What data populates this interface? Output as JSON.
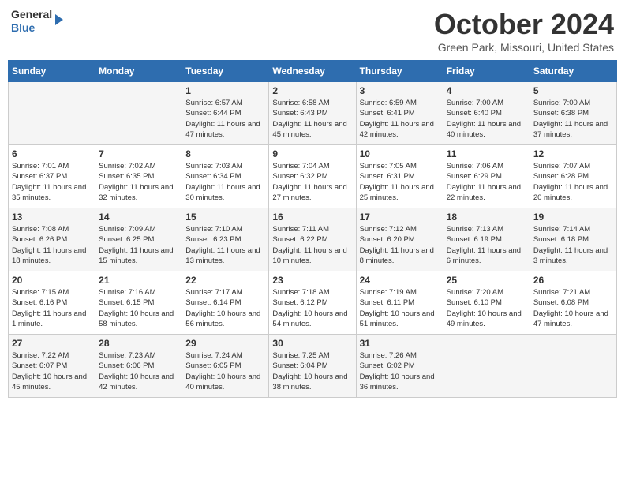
{
  "header": {
    "logo_line1": "General",
    "logo_line2": "Blue",
    "month_title": "October 2024",
    "location": "Green Park, Missouri, United States"
  },
  "weekdays": [
    "Sunday",
    "Monday",
    "Tuesday",
    "Wednesday",
    "Thursday",
    "Friday",
    "Saturday"
  ],
  "weeks": [
    [
      {
        "day": "",
        "sunrise": "",
        "sunset": "",
        "daylight": ""
      },
      {
        "day": "",
        "sunrise": "",
        "sunset": "",
        "daylight": ""
      },
      {
        "day": "1",
        "sunrise": "Sunrise: 6:57 AM",
        "sunset": "Sunset: 6:44 PM",
        "daylight": "Daylight: 11 hours and 47 minutes."
      },
      {
        "day": "2",
        "sunrise": "Sunrise: 6:58 AM",
        "sunset": "Sunset: 6:43 PM",
        "daylight": "Daylight: 11 hours and 45 minutes."
      },
      {
        "day": "3",
        "sunrise": "Sunrise: 6:59 AM",
        "sunset": "Sunset: 6:41 PM",
        "daylight": "Daylight: 11 hours and 42 minutes."
      },
      {
        "day": "4",
        "sunrise": "Sunrise: 7:00 AM",
        "sunset": "Sunset: 6:40 PM",
        "daylight": "Daylight: 11 hours and 40 minutes."
      },
      {
        "day": "5",
        "sunrise": "Sunrise: 7:00 AM",
        "sunset": "Sunset: 6:38 PM",
        "daylight": "Daylight: 11 hours and 37 minutes."
      }
    ],
    [
      {
        "day": "6",
        "sunrise": "Sunrise: 7:01 AM",
        "sunset": "Sunset: 6:37 PM",
        "daylight": "Daylight: 11 hours and 35 minutes."
      },
      {
        "day": "7",
        "sunrise": "Sunrise: 7:02 AM",
        "sunset": "Sunset: 6:35 PM",
        "daylight": "Daylight: 11 hours and 32 minutes."
      },
      {
        "day": "8",
        "sunrise": "Sunrise: 7:03 AM",
        "sunset": "Sunset: 6:34 PM",
        "daylight": "Daylight: 11 hours and 30 minutes."
      },
      {
        "day": "9",
        "sunrise": "Sunrise: 7:04 AM",
        "sunset": "Sunset: 6:32 PM",
        "daylight": "Daylight: 11 hours and 27 minutes."
      },
      {
        "day": "10",
        "sunrise": "Sunrise: 7:05 AM",
        "sunset": "Sunset: 6:31 PM",
        "daylight": "Daylight: 11 hours and 25 minutes."
      },
      {
        "day": "11",
        "sunrise": "Sunrise: 7:06 AM",
        "sunset": "Sunset: 6:29 PM",
        "daylight": "Daylight: 11 hours and 22 minutes."
      },
      {
        "day": "12",
        "sunrise": "Sunrise: 7:07 AM",
        "sunset": "Sunset: 6:28 PM",
        "daylight": "Daylight: 11 hours and 20 minutes."
      }
    ],
    [
      {
        "day": "13",
        "sunrise": "Sunrise: 7:08 AM",
        "sunset": "Sunset: 6:26 PM",
        "daylight": "Daylight: 11 hours and 18 minutes."
      },
      {
        "day": "14",
        "sunrise": "Sunrise: 7:09 AM",
        "sunset": "Sunset: 6:25 PM",
        "daylight": "Daylight: 11 hours and 15 minutes."
      },
      {
        "day": "15",
        "sunrise": "Sunrise: 7:10 AM",
        "sunset": "Sunset: 6:23 PM",
        "daylight": "Daylight: 11 hours and 13 minutes."
      },
      {
        "day": "16",
        "sunrise": "Sunrise: 7:11 AM",
        "sunset": "Sunset: 6:22 PM",
        "daylight": "Daylight: 11 hours and 10 minutes."
      },
      {
        "day": "17",
        "sunrise": "Sunrise: 7:12 AM",
        "sunset": "Sunset: 6:20 PM",
        "daylight": "Daylight: 11 hours and 8 minutes."
      },
      {
        "day": "18",
        "sunrise": "Sunrise: 7:13 AM",
        "sunset": "Sunset: 6:19 PM",
        "daylight": "Daylight: 11 hours and 6 minutes."
      },
      {
        "day": "19",
        "sunrise": "Sunrise: 7:14 AM",
        "sunset": "Sunset: 6:18 PM",
        "daylight": "Daylight: 11 hours and 3 minutes."
      }
    ],
    [
      {
        "day": "20",
        "sunrise": "Sunrise: 7:15 AM",
        "sunset": "Sunset: 6:16 PM",
        "daylight": "Daylight: 11 hours and 1 minute."
      },
      {
        "day": "21",
        "sunrise": "Sunrise: 7:16 AM",
        "sunset": "Sunset: 6:15 PM",
        "daylight": "Daylight: 10 hours and 58 minutes."
      },
      {
        "day": "22",
        "sunrise": "Sunrise: 7:17 AM",
        "sunset": "Sunset: 6:14 PM",
        "daylight": "Daylight: 10 hours and 56 minutes."
      },
      {
        "day": "23",
        "sunrise": "Sunrise: 7:18 AM",
        "sunset": "Sunset: 6:12 PM",
        "daylight": "Daylight: 10 hours and 54 minutes."
      },
      {
        "day": "24",
        "sunrise": "Sunrise: 7:19 AM",
        "sunset": "Sunset: 6:11 PM",
        "daylight": "Daylight: 10 hours and 51 minutes."
      },
      {
        "day": "25",
        "sunrise": "Sunrise: 7:20 AM",
        "sunset": "Sunset: 6:10 PM",
        "daylight": "Daylight: 10 hours and 49 minutes."
      },
      {
        "day": "26",
        "sunrise": "Sunrise: 7:21 AM",
        "sunset": "Sunset: 6:08 PM",
        "daylight": "Daylight: 10 hours and 47 minutes."
      }
    ],
    [
      {
        "day": "27",
        "sunrise": "Sunrise: 7:22 AM",
        "sunset": "Sunset: 6:07 PM",
        "daylight": "Daylight: 10 hours and 45 minutes."
      },
      {
        "day": "28",
        "sunrise": "Sunrise: 7:23 AM",
        "sunset": "Sunset: 6:06 PM",
        "daylight": "Daylight: 10 hours and 42 minutes."
      },
      {
        "day": "29",
        "sunrise": "Sunrise: 7:24 AM",
        "sunset": "Sunset: 6:05 PM",
        "daylight": "Daylight: 10 hours and 40 minutes."
      },
      {
        "day": "30",
        "sunrise": "Sunrise: 7:25 AM",
        "sunset": "Sunset: 6:04 PM",
        "daylight": "Daylight: 10 hours and 38 minutes."
      },
      {
        "day": "31",
        "sunrise": "Sunrise: 7:26 AM",
        "sunset": "Sunset: 6:02 PM",
        "daylight": "Daylight: 10 hours and 36 minutes."
      },
      {
        "day": "",
        "sunrise": "",
        "sunset": "",
        "daylight": ""
      },
      {
        "day": "",
        "sunrise": "",
        "sunset": "",
        "daylight": ""
      }
    ]
  ]
}
